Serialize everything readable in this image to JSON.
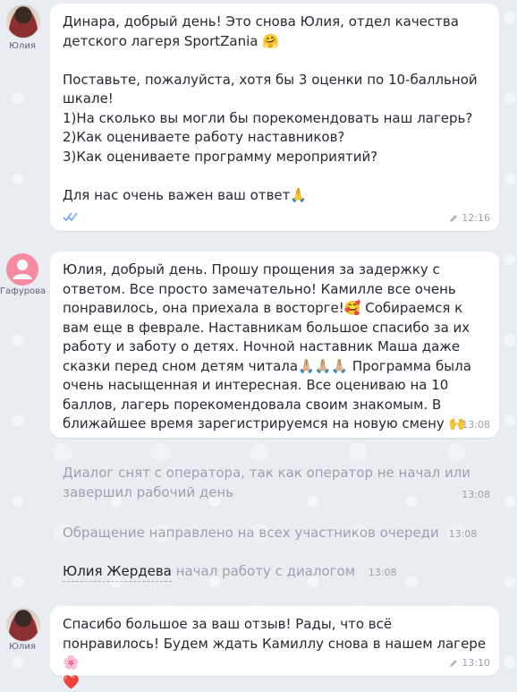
{
  "messages": [
    {
      "sender": "Юлия",
      "text": "Динара, добрый день! Это снова Юлия, отдел качества детского лагеря SportZania 🤗\n\nПоставьте, пожалуйста, хотя бы 3 оценки по 10-балльной шкале!\n1)На сколько вы могли бы порекомендовать наш лагерь?\n2)Как оцениваете работу наставников?\n3)Как оцениваете программу мероприятий?\n\nДля нас очень важен ваш ответ🙏",
      "time": "12:16"
    },
    {
      "sender": "Гафурова",
      "text": "Юлия, добрый день. Прошу прощения за задержку с ответом. Все просто замечательно! Камилле все очень понравилось, она приехала в восторге!🥰 Собираемся к вам еще в феврале. Наставникам большое спасибо за их работу и заботу о детях. Ночной наставник Маша даже сказки перед сном детям читала🙏🏼🙏🏼🙏🏼 Программа была очень насыщенная и интересная. Все оцениваю на 10 баллов, лагерь порекомендовала своим знакомым. В ближайшее время зарегистрируемся на новую смену 🙌",
      "time": "13:08"
    },
    {
      "sender": "Юлия",
      "text": "Спасибо большое за ваш отзыв! Рады, что всё понравилось! Будем ждать Камиллу снова в нашем лагере🌸\n❤️",
      "time": "13:10"
    }
  ],
  "system": [
    {
      "text": "Диалог снят с оператора, так как оператор не начал или завершил рабочий день",
      "time": "13:08"
    },
    {
      "text": "Обращение направлено на всех участников очереди",
      "time": "13:08"
    },
    {
      "operator": "Юлия Жердева",
      "text": "начал работу с диалогом",
      "time": "13:08"
    }
  ],
  "icons": {
    "edit": "pencil-icon",
    "read": "double-check-icon",
    "avatar_default": "user-icon"
  },
  "colors": {
    "bg": "#e9edf1",
    "bubble": "#ffffff",
    "muted": "#9aa2aa",
    "avatar_default": "#f58aa0",
    "read_ticks": "#72a7ff"
  }
}
